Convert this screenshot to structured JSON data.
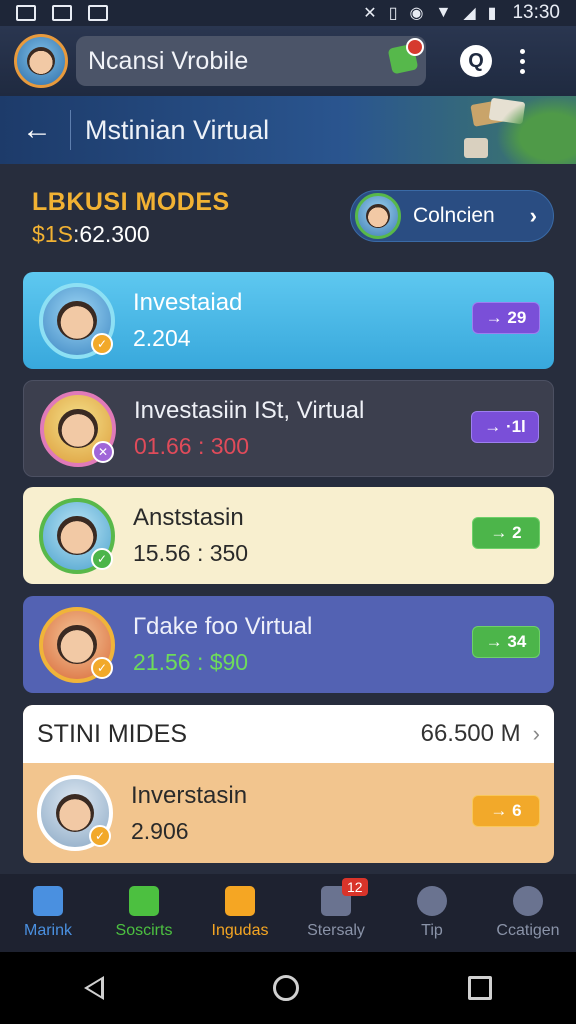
{
  "status_bar": {
    "time": "13:30",
    "icons": [
      "image-icon",
      "gallery-icon",
      "mail-icon",
      "bluetooth-off-icon",
      "sim-icon",
      "sync-icon",
      "wifi-icon",
      "signal-icon",
      "battery-icon"
    ]
  },
  "app_bar": {
    "title": "Ncansi Vrobile",
    "search_label": "Q"
  },
  "sub_header": {
    "back_glyph": "←",
    "title": "Mstinian Virtual"
  },
  "summary": {
    "label": "LBKUSI MODES",
    "currency": "$1S",
    "value": ":62.300",
    "collect_label": "Colncien",
    "collect_chevron": "›"
  },
  "cards": [
    {
      "title": "Investaiad",
      "value": "2.204",
      "pill": "→ 29",
      "color": "#5ec8f0"
    },
    {
      "title": "Investasiin ISt, Virtual",
      "value": "01.66 : 300",
      "pill": "→ ·1l",
      "color": "#3c3f4e"
    },
    {
      "title": "Anststasin",
      "value": "15.56 : 350",
      "pill": "→ 2",
      "color": "#f8efcf"
    },
    {
      "title": "Гdake foo Virtual",
      "value": "21.56 : $90",
      "pill": "→ 34",
      "color": "#5362b3"
    }
  ],
  "section": {
    "title": "STINI MIDES",
    "total": "66.500 M",
    "chevron": "›",
    "row": {
      "title": "Inverstasin",
      "value": "2.906",
      "pill": "→ 6"
    }
  },
  "bottom_nav": [
    {
      "label": "Marink",
      "color": "#4a90e0",
      "icon": "map-icon"
    },
    {
      "label": "Soscirts",
      "color": "#4cc040",
      "icon": "chat-icon"
    },
    {
      "label": "Ingudas",
      "color": "#f5a623",
      "icon": "folder-icon"
    },
    {
      "label": "Stersaly",
      "color": "#8a93a8",
      "icon": "calendar-icon",
      "badge": "12"
    },
    {
      "label": "Tip",
      "color": "#8a93a8",
      "icon": "gear-icon"
    },
    {
      "label": "Ccatigen",
      "color": "#8a93a8",
      "icon": "settings-icon"
    }
  ]
}
